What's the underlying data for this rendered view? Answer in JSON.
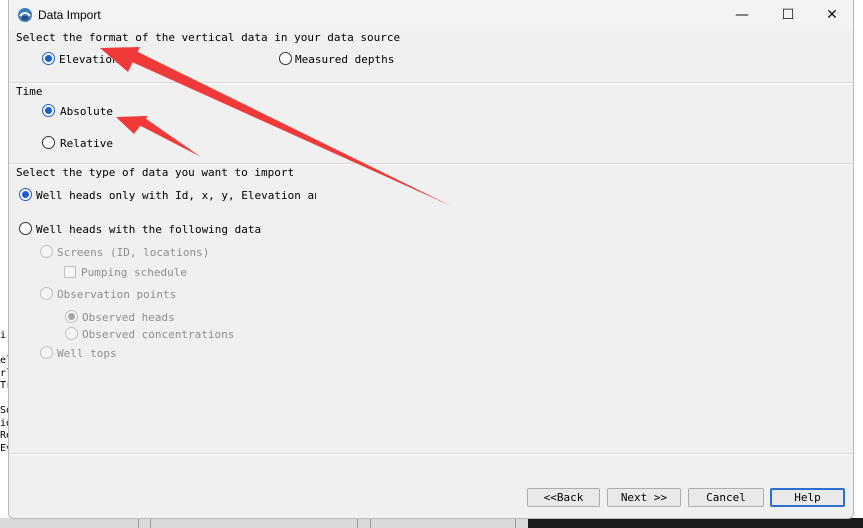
{
  "window": {
    "title": "Data Import",
    "controls": {
      "minimize": "—",
      "maximize": "☐",
      "close": "✕"
    }
  },
  "vertical_format": {
    "heading": "Select the format of the vertical data in your data source",
    "options": [
      {
        "label": "Elevation",
        "selected": true
      },
      {
        "label": "Measured depths",
        "selected": false
      }
    ]
  },
  "time": {
    "heading": "Time",
    "options": [
      {
        "label": "Absolute",
        "selected": true
      },
      {
        "label": "Relative",
        "selected": false
      }
    ]
  },
  "data_type": {
    "heading": "Select the type of data you want to import",
    "option_heads_only": "Well heads only with Id, x, y, Elevation and de",
    "option_heads_with_data": "Well heads with the following data",
    "screens": "Screens (ID, locations)",
    "pumping_schedule": "Pumping schedule",
    "observation_points": "Observation points",
    "observed_heads": "Observed heads",
    "observed_concentrations": "Observed concentrations",
    "well_tops": "Well tops"
  },
  "buttons": {
    "back": "<<Back",
    "next": "Next >>",
    "cancel": "Cancel",
    "help": "Help"
  },
  "background": {
    "left_text": "i\n\nel\nrl\nTr\n\nSo\nid\nRe\nEv"
  },
  "colors": {
    "accent": "#1b5fc9",
    "annotation_arrow": "#f03a3a",
    "dialog_bg": "#f0f0f0"
  }
}
